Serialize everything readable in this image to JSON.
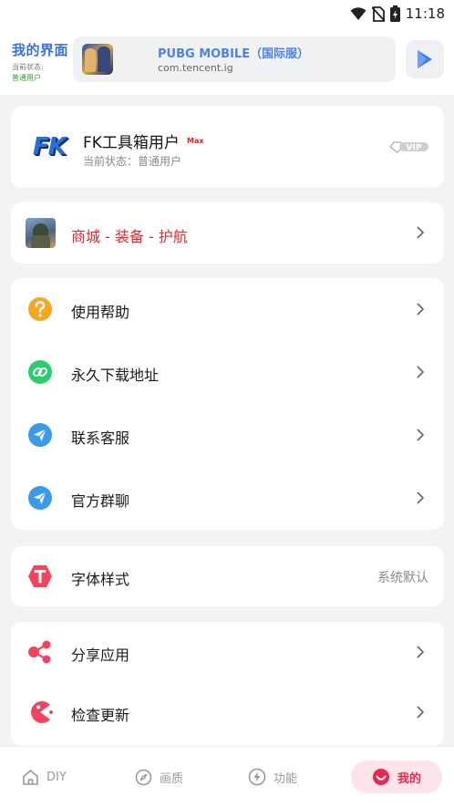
{
  "status_bar": {
    "time": "11:18"
  },
  "header": {
    "title": "我的界面",
    "status_label": "当前状态:",
    "status_value": "普通用户",
    "game": {
      "name": "PUBG MOBILE（国际服）",
      "package": "com.tencent.ig"
    }
  },
  "user": {
    "logo_text": "FK",
    "name": "FK工具箱用户",
    "badge": "Max",
    "status": "当前状态：普通用户",
    "vip_text": "VIP"
  },
  "shop": {
    "label": "商城 - 装备 - 护航"
  },
  "menu": [
    {
      "label": "使用帮助",
      "icon": "question-icon"
    },
    {
      "label": "永久下载地址",
      "icon": "link-icon"
    },
    {
      "label": "联系客服",
      "icon": "send-icon"
    },
    {
      "label": "官方群聊",
      "icon": "send-icon"
    }
  ],
  "font_setting": {
    "label": "字体样式",
    "value": "系统默认",
    "icon": "font-t-icon"
  },
  "extra_menu": [
    {
      "label": "分享应用",
      "icon": "share-icon"
    },
    {
      "label": "检查更新",
      "icon": "update-icon"
    }
  ],
  "bottom_nav": [
    {
      "label": "DIY",
      "icon": "home-icon"
    },
    {
      "label": "画质",
      "icon": "compass-icon"
    },
    {
      "label": "功能",
      "icon": "bolt-icon"
    },
    {
      "label": "我的",
      "icon": "smile-icon",
      "active": true
    }
  ],
  "colors": {
    "accent_blue": "#3b6fe0",
    "accent_red": "#e0282d",
    "nav_active_bg": "#fde4ea",
    "nav_active_text": "#e8294f"
  }
}
